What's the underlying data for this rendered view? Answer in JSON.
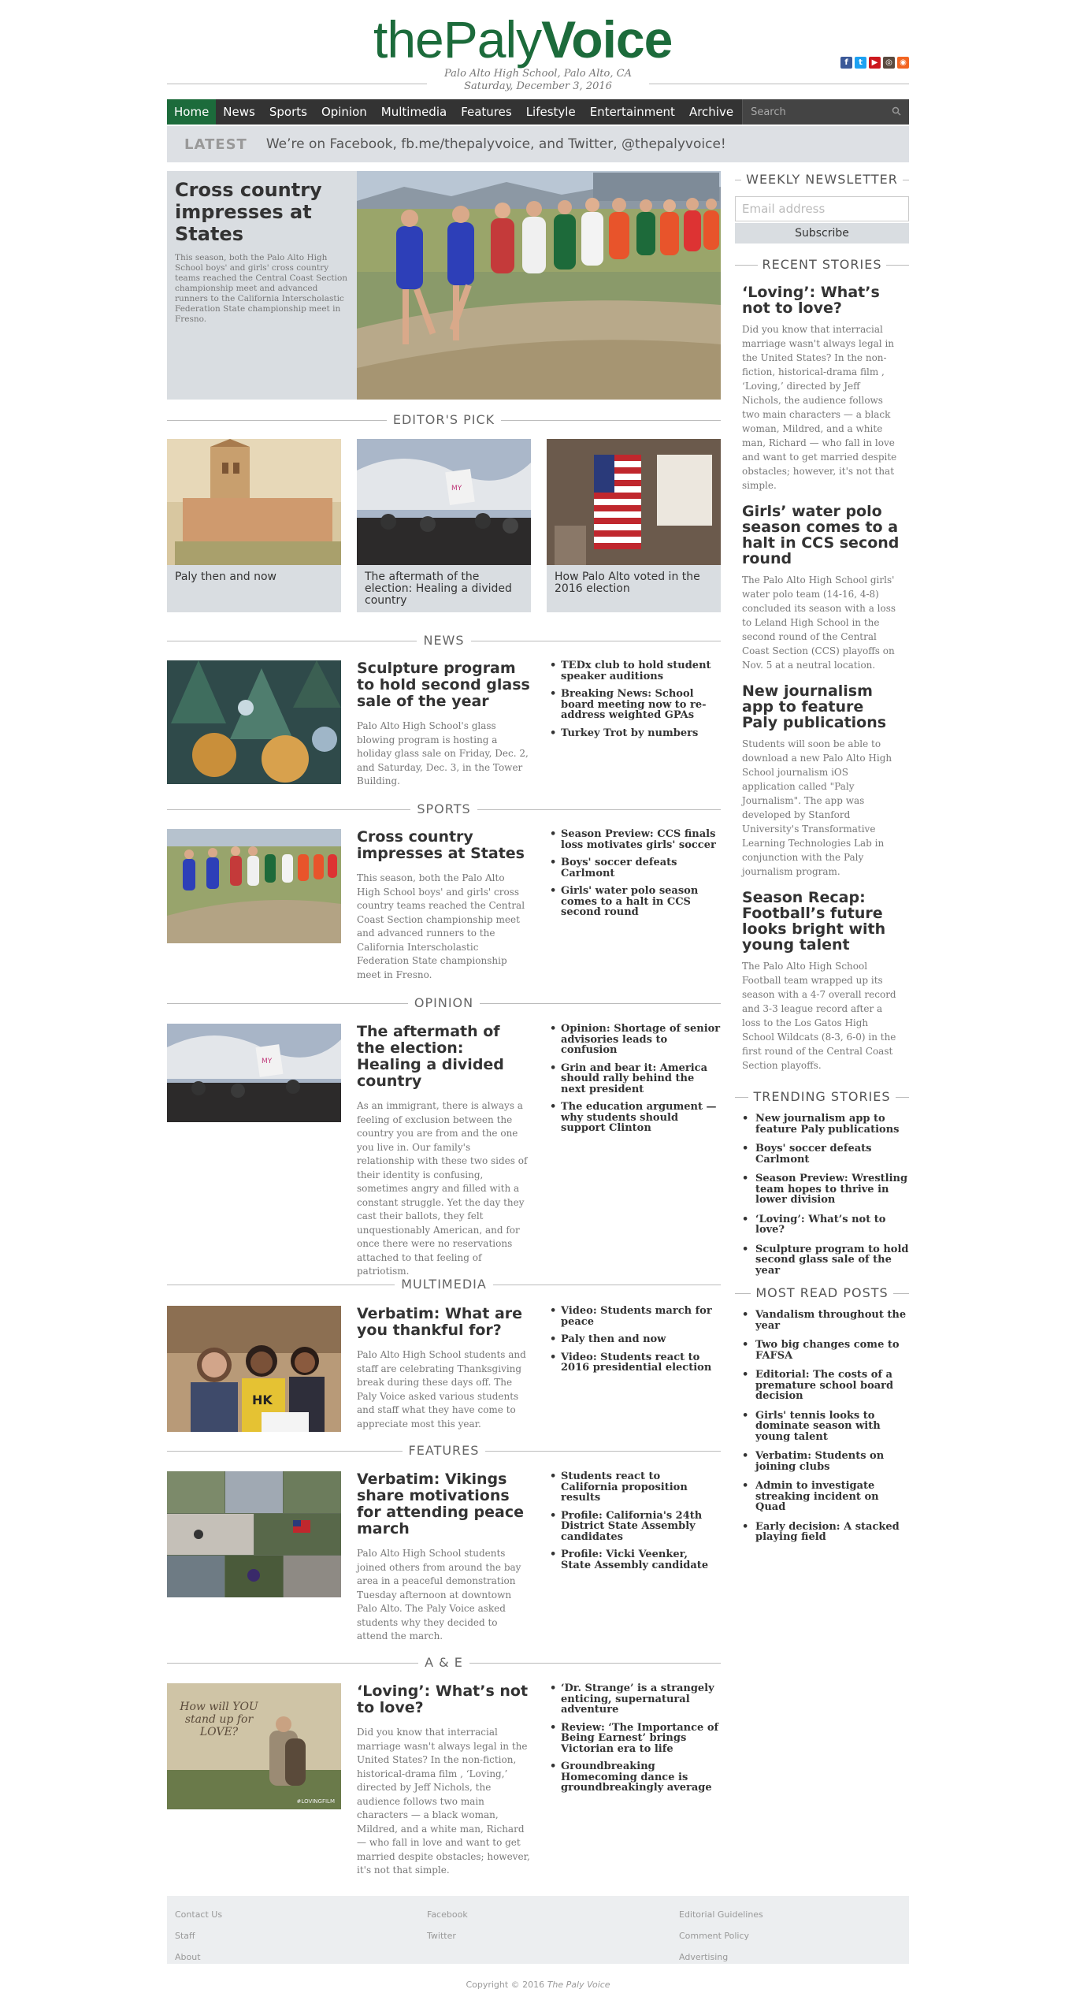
{
  "site": {
    "logo_thin": "thePaly",
    "logo_bold": "Voice",
    "location": "Palo Alto High School, Palo Alto, CA",
    "date": "Saturday, December 3, 2016",
    "social": [
      {
        "name": "facebook-icon",
        "glyph": "f",
        "color": "#3b5998"
      },
      {
        "name": "twitter-icon",
        "glyph": "t",
        "color": "#1da1f2"
      },
      {
        "name": "youtube-icon",
        "glyph": "▶",
        "color": "#cc181e"
      },
      {
        "name": "instagram-icon",
        "glyph": "◎",
        "color": "#5a4a3f"
      },
      {
        "name": "rss-icon",
        "glyph": "◉",
        "color": "#f26522"
      }
    ]
  },
  "nav": {
    "items": [
      "Home",
      "News",
      "Sports",
      "Opinion",
      "Multimedia",
      "Features",
      "Lifestyle",
      "Entertainment",
      "Archive"
    ],
    "search_placeholder": "Search"
  },
  "latest": {
    "label": "LATEST",
    "text": "We’re on Facebook, fb.me/thepalyvoice, and Twitter, @thepalyvoice!"
  },
  "hero": {
    "title": "Cross country impresses at States",
    "excerpt": "This season, both the Palo Alto High School boys' and girls' cross country teams reached the Central Coast Section championship meet and advanced runners to the California Interscholastic Federation State championship meet in Fresno."
  },
  "editors_pick": {
    "heading": "EDITOR'S PICK",
    "items": [
      "Paly then and now",
      "The aftermath of the election: Healing a divided country",
      "How Palo Alto voted in the 2016 election"
    ]
  },
  "sections": {
    "news": {
      "heading": "NEWS",
      "title": "Sculpture program to hold second glass sale of the year",
      "excerpt": "Palo Alto High School's glass blowing program is hosting a holiday glass sale on Friday, Dec. 2, and Saturday, Dec. 3, in the Tower Building.",
      "list": [
        "TEDx club to hold student speaker auditions",
        "Breaking News: School board meeting now to re-address weighted GPAs",
        "Turkey Trot by numbers"
      ]
    },
    "sports": {
      "heading": "SPORTS",
      "title": "Cross country impresses at States",
      "excerpt": "This season, both the Palo Alto High School boys' and girls' cross country teams reached the Central Coast Section championship meet and advanced runners to the California Interscholastic Federation State championship meet in Fresno.",
      "list": [
        "Season Preview: CCS finals loss motivates girls' soccer",
        "Boys' soccer defeats Carlmont",
        "Girls' water polo season comes to a halt in CCS second round"
      ]
    },
    "opinion": {
      "heading": "OPINION",
      "title": "The aftermath of the election: Healing a divided country",
      "excerpt": "As an immigrant, there is always a feeling of exclusion between the country you are from and the one you live in. Our family's relationship with these two sides of their identity is confusing, sometimes angry and filled with a constant struggle. Yet the day they cast their ballots, they felt unquestionably American, and for once there were no reservations attached to that feeling of patriotism.",
      "list": [
        "Opinion: Shortage of senior advisories leads to confusion",
        "Grin and bear it: America should rally behind the next president",
        "The education argument — why students should support Clinton"
      ]
    },
    "multimedia": {
      "heading": "MULTIMEDIA",
      "title": "Verbatim: What are you thankful for?",
      "excerpt": "Palo Alto High School students and staff are celebrating Thanksgiving break during these days off. The Paly Voice asked various students and staff what they have come to appreciate most this year.",
      "list": [
        "Video: Students march for peace",
        "Paly then and now",
        "Video: Students react to 2016 presidential election"
      ]
    },
    "features": {
      "heading": "FEATURES",
      "title": "Verbatim: Vikings share motivations for attending peace march",
      "excerpt": "Palo Alto High School students joined others from around the bay area in a peaceful demonstration Tuesday afternoon at downtown Palo Alto. The Paly Voice asked students why they decided to attend the march.",
      "list": [
        "Students react to California proposition results",
        "Profile: California's 24th District State Assembly candidates",
        "Profile: Vicki Veenker, State Assembly candidate"
      ]
    },
    "ae": {
      "heading": "A & E",
      "title": "‘Loving’: What’s not to love?",
      "excerpt": "Did you know that interracial marriage wasn't always legal in the United States? In the non-fiction, historical-drama film , ‘Loving,’ directed by Jeff Nichols, the audience follows two main characters — a black woman, Mildred, and a white man, Richard — who fall in love and want to get married despite obstacles; however, it's not that simple.",
      "list": [
        "‘Dr. Strange’ is a strangely enticing, supernatural adventure",
        "Review: ‘The Importance of Being Earnest’ brings Victorian era to life",
        "Groundbreaking Homecoming dance is groundbreakingly average"
      ],
      "poster_text": "How will YOU stand up for LOVE?",
      "poster_tag": "#LOVINGFILM"
    }
  },
  "sidebar": {
    "newsletter_heading": "WEEKLY NEWSLETTER",
    "email_placeholder": "Email address",
    "subscribe": "Subscribe",
    "recent_heading": "RECENT STORIES",
    "recent": [
      {
        "title": "‘Loving’: What’s not to love?",
        "excerpt": "Did you know that interracial marriage wasn't always legal in the United States? In the non-fiction, historical-drama film , ‘Loving,’ directed by Jeff Nichols, the audience follows two main characters — a black woman, Mildred, and a white man, Richard — who fall in love and want to get married despite obstacles; however, it's not that simple."
      },
      {
        "title": "Girls’ water polo season comes to a halt in CCS second round",
        "excerpt": "The Palo Alto High School girls' water polo team (14-16, 4-8) concluded its season with a loss to Leland High School in the second round of the Central Coast Section (CCS) playoffs on Nov. 5 at a neutral location."
      },
      {
        "title": "New journalism app to feature Paly publications",
        "excerpt": "Students will soon be able to download a new Palo Alto High School journalism iOS application called \"Paly Journalism\". The app was developed by Stanford University's Transformative Learning Technologies Lab in conjunction with the Paly journalism program."
      },
      {
        "title": "Season Recap: Football’s future looks bright with young talent",
        "excerpt": "The Palo Alto High School Football team wrapped up its season with a 4-7 overall record and 3-3 league record after a loss to the Los Gatos High School Wildcats (8-3, 6-0) in the first round of the Central Coast Section playoffs."
      }
    ],
    "trending_heading": "TRENDING STORIES",
    "trending": [
      "New journalism app to feature Paly publications",
      "Boys' soccer defeats Carlmont",
      "Season Preview: Wrestling team hopes to thrive in lower division",
      "‘Loving’: What’s not to love?",
      "Sculpture program to hold second glass sale of the year"
    ],
    "most_read_heading": "MOST READ POSTS",
    "most_read": [
      "Vandalism throughout the year",
      "Two big changes come to FAFSA",
      "Editorial: The costs of a premature school board decision",
      "Girls' tennis looks to dominate season with young talent",
      "Verbatim: Students on joining clubs",
      "Admin to investigate streaking incident on Quad",
      "Early decision: A stacked playing field"
    ]
  },
  "footer": {
    "col1": [
      "Contact Us",
      "Staff",
      "About"
    ],
    "col2": [
      "Facebook",
      "Twitter"
    ],
    "col3": [
      "Editorial Guidelines",
      "Comment Policy",
      "Advertising"
    ],
    "copyright": "Copyright © 2016",
    "copyright_name": "The Paly Voice"
  }
}
